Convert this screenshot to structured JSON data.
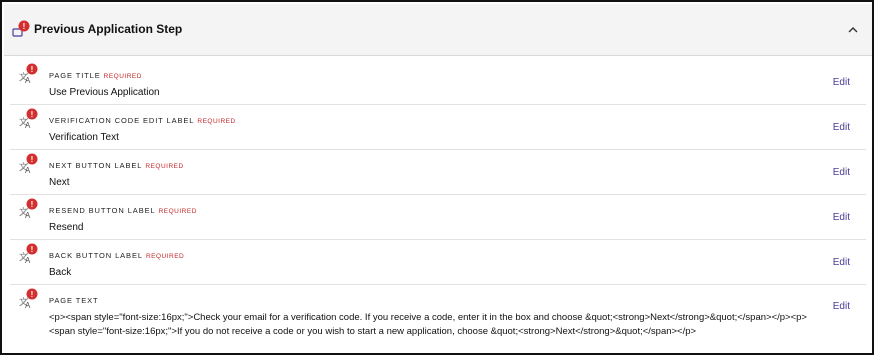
{
  "section": {
    "title": "Previous Application Step",
    "expanded": true,
    "warning_mark": "!"
  },
  "fields": [
    {
      "label": "PAGE TITLE",
      "required_text": "REQUIRED",
      "value": "Use Previous Application",
      "edit_label": "Edit"
    },
    {
      "label": "VERIFICATION CODE EDIT LABEL",
      "required_text": "REQUIRED",
      "value": "Verification Text",
      "edit_label": "Edit"
    },
    {
      "label": "NEXT BUTTON LABEL",
      "required_text": "REQUIRED",
      "value": "Next",
      "edit_label": "Edit"
    },
    {
      "label": "RESEND BUTTON LABEL",
      "required_text": "REQUIRED",
      "value": "Resend",
      "edit_label": "Edit"
    },
    {
      "label": "BACK BUTTON LABEL",
      "required_text": "REQUIRED",
      "value": "Back",
      "edit_label": "Edit"
    },
    {
      "label": "PAGE TEXT",
      "required_text": "",
      "value": "<p><span style=\"font-size:16px;\">Check your email for a verification code. If you receive a code, enter it in the box and choose &quot;<strong>Next</strong>&quot;</span></p><p><span style=\"font-size:16px;\">If you do not receive a code or you wish to start a new application, choose &quot;<strong>Next</strong>&quot;</span></p>",
      "edit_label": "Edit"
    }
  ],
  "colors": {
    "warning_badge": "#d32f2f",
    "edit_link": "#4b3a9a",
    "required": "#c62828",
    "header_bg": "#f4f4f4"
  },
  "icons": {
    "section": "message-warning-icon",
    "field": "translate-warning-icon",
    "collapse": "chevron-up-icon"
  }
}
